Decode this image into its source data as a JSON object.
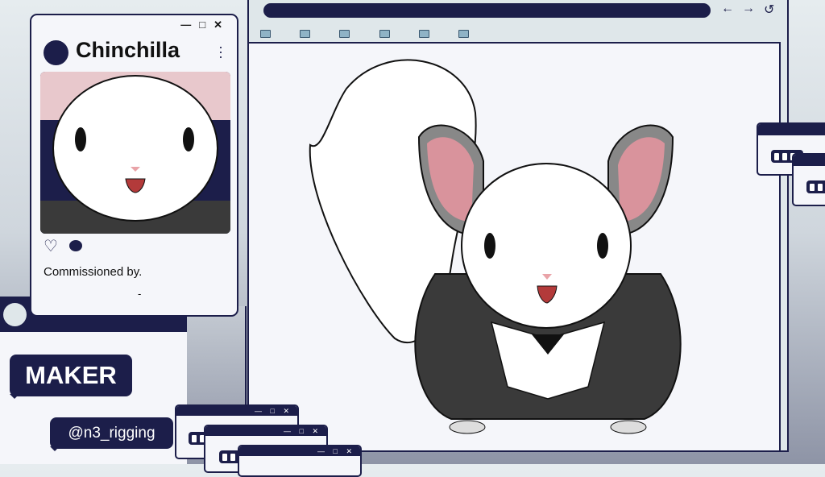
{
  "profile_card": {
    "title": "Chinchilla",
    "window_controls": [
      "—",
      "□",
      "✕"
    ],
    "menu_icon": "kebab-menu-icon",
    "icons": [
      "heart-icon",
      "speech-bubble-icon"
    ],
    "caption": "Commissioned by.",
    "commissioner": "-"
  },
  "maker": {
    "label": "MAKER",
    "handle": "@n3_rigging"
  },
  "browser": {
    "nav_icons": [
      "back-arrow-icon",
      "forward-arrow-icon",
      "refresh-icon"
    ],
    "folder_count": 6
  },
  "mini_window_controls": "— □ ✕",
  "colors": {
    "navy": "#1c1e4a",
    "folder": "#8fb3c6",
    "panel": "#f5f6fa"
  }
}
